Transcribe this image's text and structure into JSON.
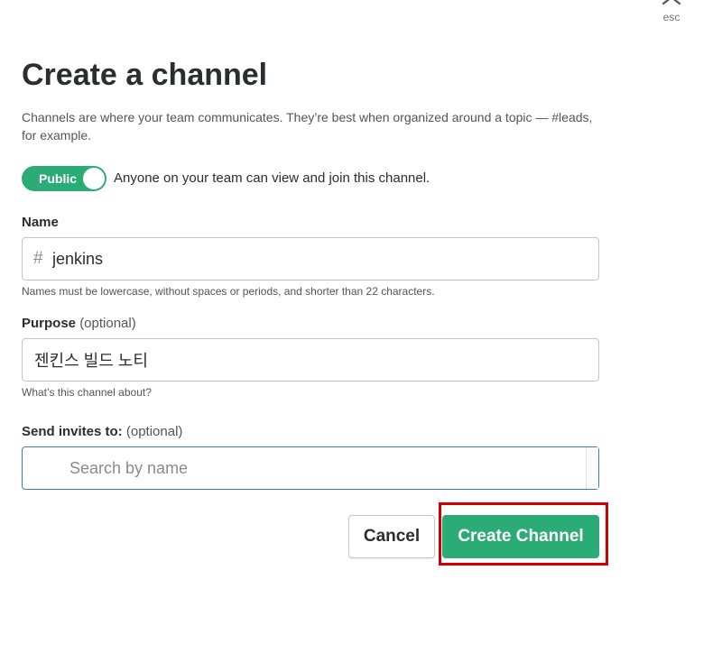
{
  "dialog": {
    "close_hint": "esc",
    "title": "Create a channel",
    "description": "Channels are where your team communicates. They’re best when organized around a topic — #leads, for example."
  },
  "visibility": {
    "toggle_label": "Public",
    "description": "Anyone on your team can view and join this channel."
  },
  "name_field": {
    "label": "Name",
    "prefix": "#",
    "value": "jenkins",
    "hint": "Names must be lowercase, without spaces or periods, and shorter than 22 characters."
  },
  "purpose_field": {
    "label": "Purpose",
    "optional": "(optional)",
    "value": "젠킨스 빌드 노티",
    "hint": "What’s this channel about?"
  },
  "invite_field": {
    "label": "Send invites to:",
    "optional": "(optional)",
    "placeholder": "Search by name",
    "value": ""
  },
  "actions": {
    "cancel_label": "Cancel",
    "create_label": "Create Channel"
  },
  "colors": {
    "accent_green": "#2bac76",
    "focus_blue": "#3b7bc0",
    "highlight_red": "#cc0000"
  }
}
